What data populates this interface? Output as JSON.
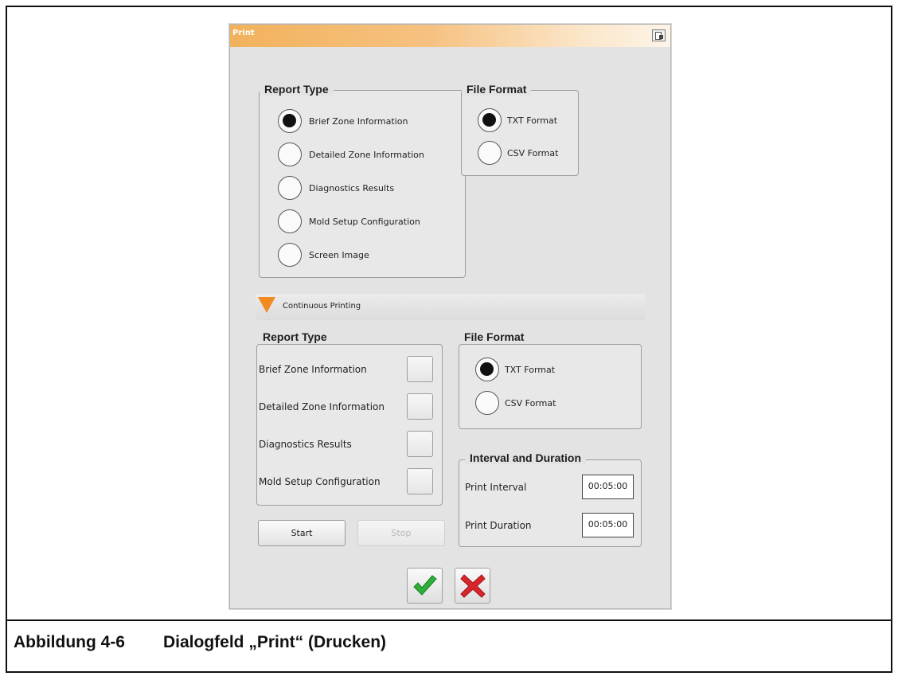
{
  "dialog": {
    "title": "Print",
    "top_section": {
      "report_type": {
        "legend": "Report Type",
        "options": [
          {
            "label": "Brief Zone Information",
            "selected": true
          },
          {
            "label": "Detailed Zone Information",
            "selected": false
          },
          {
            "label": "Diagnostics Results",
            "selected": false
          },
          {
            "label": "Mold Setup Configuration",
            "selected": false
          },
          {
            "label": "Screen Image",
            "selected": false
          }
        ]
      },
      "file_format": {
        "legend": "File Format",
        "options": [
          {
            "label": "TXT Format",
            "selected": true
          },
          {
            "label": "CSV Format",
            "selected": false
          }
        ]
      }
    },
    "continuous_printing": {
      "expander_label": "Continuous Printing",
      "report_type": {
        "legend": "Report Type",
        "items": [
          {
            "label": "Brief Zone Information",
            "checked": false
          },
          {
            "label": "Detailed Zone Information",
            "checked": false
          },
          {
            "label": "Diagnostics Results",
            "checked": false
          },
          {
            "label": "Mold Setup Configuration",
            "checked": false
          }
        ]
      },
      "file_format": {
        "legend": "File Format",
        "options": [
          {
            "label": "TXT Format",
            "selected": true
          },
          {
            "label": "CSV Format",
            "selected": false
          }
        ]
      },
      "interval_duration": {
        "legend": "Interval and Duration",
        "print_interval_label": "Print Interval",
        "print_interval_value": "00:05:00",
        "print_duration_label": "Print Duration",
        "print_duration_value": "00:05:00"
      },
      "start_label": "Start",
      "stop_label": "Stop"
    },
    "icons": {
      "title_icon": "window-icon",
      "expander_icon": "triangle-down-icon",
      "ok_icon": "checkmark-icon",
      "cancel_icon": "x-icon"
    },
    "colors": {
      "title_orange": "#f2b25c",
      "ok_green": "#2fae3a",
      "cancel_red": "#d9262b",
      "expander_orange": "#f28a1f"
    }
  },
  "caption": {
    "number": "Abbildung 4-6",
    "text": "Dialogfeld „Print“ (Drucken)"
  }
}
